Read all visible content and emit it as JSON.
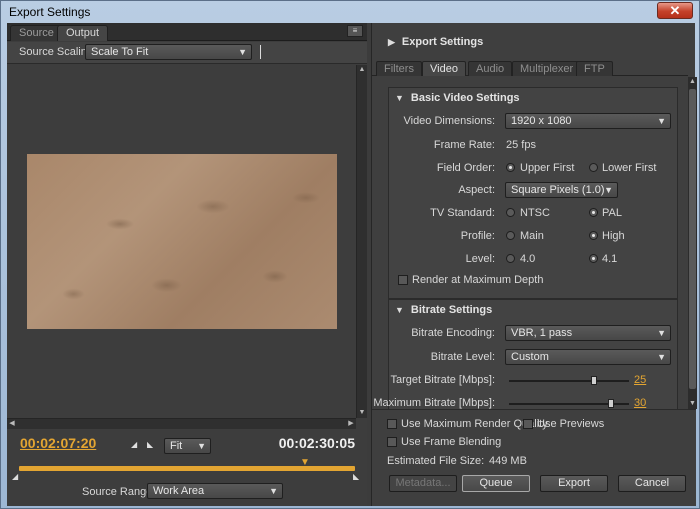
{
  "window": {
    "title": "Export Settings",
    "close_glyph": "✕"
  },
  "left": {
    "tabs": [
      {
        "label": "Source"
      },
      {
        "label": "Output"
      }
    ],
    "panel_menu_icon": "≡",
    "source_scaling": {
      "label": "Source Scaling:",
      "value": "Scale To Fit"
    },
    "timecode_current": "00:02:07:20",
    "timecode_duration": "00:02:30:05",
    "zoom": {
      "value": "Fit"
    },
    "playhead_position": 0.86,
    "source_range": {
      "label": "Source Range:",
      "value": "Work Area"
    }
  },
  "right": {
    "export_settings_header": "Export Settings",
    "tabs": [
      {
        "label": "Filters"
      },
      {
        "label": "Video"
      },
      {
        "label": "Audio"
      },
      {
        "label": "Multiplexer"
      },
      {
        "label": "FTP"
      }
    ],
    "basic_video": {
      "title": "Basic Video Settings",
      "video_dimensions": {
        "label": "Video Dimensions:",
        "value": "1920 x 1080"
      },
      "frame_rate": {
        "label": "Frame Rate:",
        "value": "25 fps"
      },
      "field_order": {
        "label": "Field Order:",
        "opt1": "Upper First",
        "opt2": "Lower First",
        "selected": "Upper First"
      },
      "aspect": {
        "label": "Aspect:",
        "value": "Square Pixels (1.0)"
      },
      "tv_standard": {
        "label": "TV Standard:",
        "opt1": "NTSC",
        "opt2": "PAL",
        "selected": "PAL"
      },
      "profile": {
        "label": "Profile:",
        "opt1": "Main",
        "opt2": "High",
        "selected": "High"
      },
      "level": {
        "label": "Level:",
        "opt1": "4.0",
        "opt2": "4.1",
        "selected": "4.1"
      },
      "render_max_depth": {
        "label": "Render at Maximum Depth",
        "checked": false
      }
    },
    "bitrate": {
      "title": "Bitrate Settings",
      "encoding": {
        "label": "Bitrate Encoding:",
        "value": "VBR, 1 pass"
      },
      "level": {
        "label": "Bitrate Level:",
        "value": "Custom"
      },
      "target": {
        "label": "Target Bitrate [Mbps]:",
        "value": "25",
        "fraction": 0.71
      },
      "maximum": {
        "label": "Maximum Bitrate [Mbps]:",
        "value": "30",
        "fraction": 0.85
      }
    },
    "use_max_render_quality": {
      "label": "Use Maximum Render Quality",
      "checked": false
    },
    "use_previews": {
      "label": "Use Previews",
      "checked": false
    },
    "use_frame_blending": {
      "label": "Use Frame Blending",
      "checked": false
    },
    "estimated_file_size": {
      "label": "Estimated File Size:",
      "value": "449 MB"
    },
    "buttons": {
      "metadata": "Metadata...",
      "queue": "Queue",
      "export": "Export",
      "cancel": "Cancel"
    }
  }
}
